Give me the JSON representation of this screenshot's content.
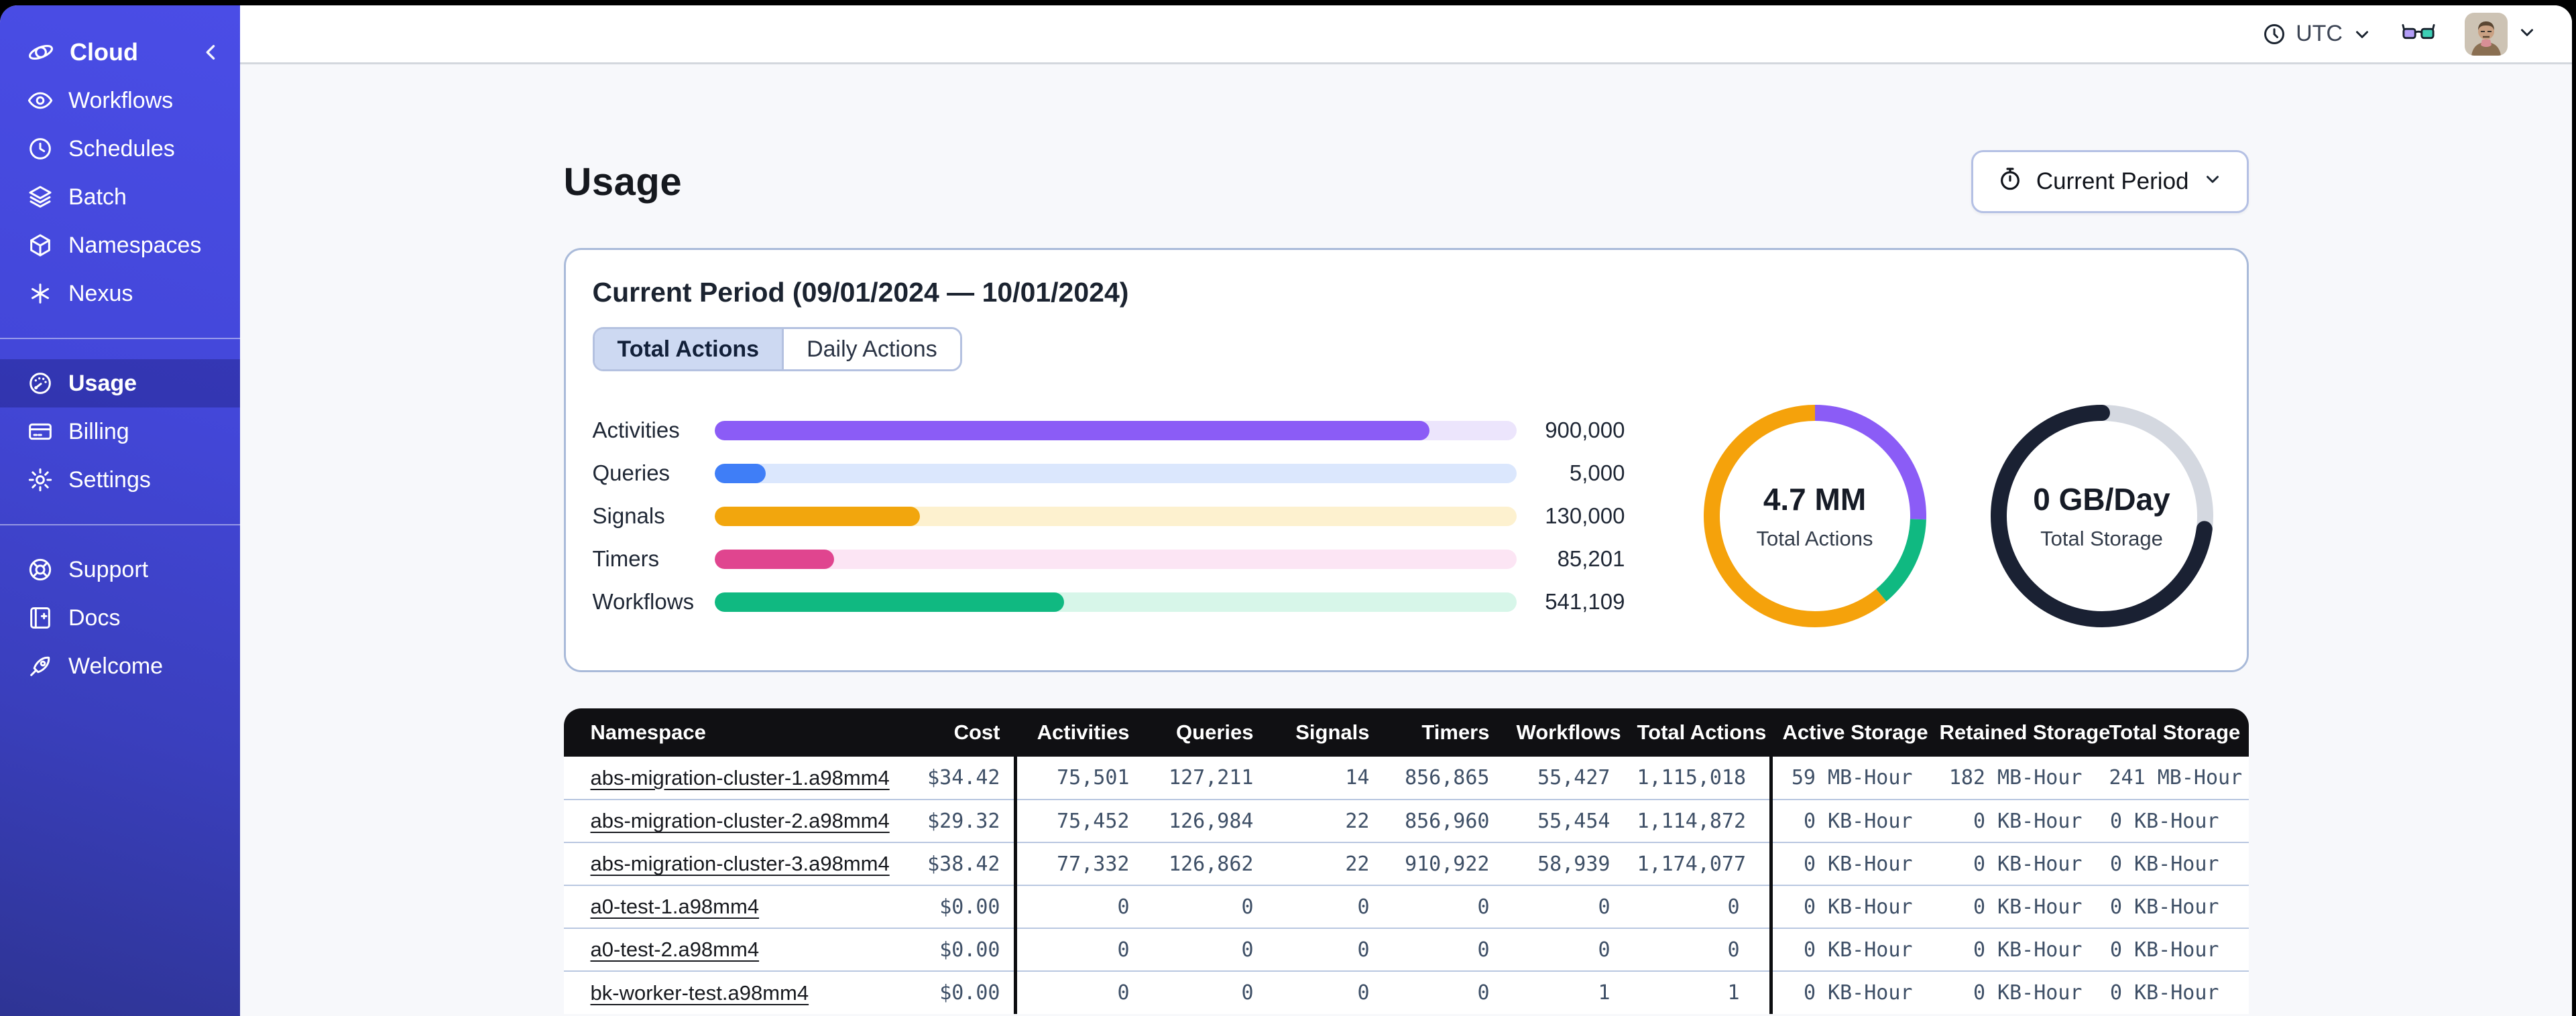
{
  "sidebar": {
    "brand": {
      "icon": "temporal-logo-icon",
      "label": "Cloud"
    },
    "groups": [
      [
        {
          "icon": "workflows-icon",
          "label": "Workflows"
        },
        {
          "icon": "schedules-icon",
          "label": "Schedules"
        },
        {
          "icon": "batch-icon",
          "label": "Batch"
        },
        {
          "icon": "namespaces-icon",
          "label": "Namespaces"
        },
        {
          "icon": "nexus-icon",
          "label": "Nexus"
        }
      ],
      [
        {
          "icon": "usage-icon",
          "label": "Usage",
          "active": true
        },
        {
          "icon": "billing-icon",
          "label": "Billing"
        },
        {
          "icon": "settings-icon",
          "label": "Settings"
        }
      ],
      [
        {
          "icon": "support-icon",
          "label": "Support"
        },
        {
          "icon": "docs-icon",
          "label": "Docs"
        },
        {
          "icon": "welcome-icon",
          "label": "Welcome"
        }
      ]
    ]
  },
  "topbar": {
    "timezone_label": "UTC",
    "icons": [
      "clock-icon",
      "chevron-down-icon",
      "glasses-icon",
      "user-avatar",
      "chevron-down-icon"
    ]
  },
  "page": {
    "title": "Usage",
    "period_button_label": "Current Period",
    "period_button_icon": "stopwatch-icon"
  },
  "card": {
    "title": "Current Period (09/01/2024 — 10/01/2024)",
    "tabs": [
      {
        "label": "Total Actions",
        "selected": true
      },
      {
        "label": "Daily Actions",
        "selected": false
      }
    ]
  },
  "chart_data": [
    {
      "type": "bar",
      "title": "Usage by action type (current period)",
      "orientation": "horizontal",
      "categories": [
        "Activities",
        "Queries",
        "Signals",
        "Timers",
        "Workflows"
      ],
      "values": [
        900000,
        5000,
        130000,
        85201,
        541109
      ],
      "value_labels": [
        "900,000",
        "5,000",
        "130,000",
        "85,201",
        "541,109"
      ],
      "fill_pct": [
        89.2,
        6.4,
        25.6,
        14.9,
        43.6
      ],
      "bar_colors": [
        "#8b5cf6",
        "#3f7ef7",
        "#f2a60d",
        "#e0458f",
        "#10b981"
      ],
      "track_colors": [
        "#ece5fc",
        "#dbe7fd",
        "#fdf1cf",
        "#fce5f4",
        "#d7f6e9"
      ]
    },
    {
      "type": "pie",
      "title": "Total Actions donut",
      "center_value": "4.7 MM",
      "center_label": "Total Actions",
      "rounded_caps": false,
      "segments": [
        {
          "name": "purple-segment",
          "color": "#8b5cf6",
          "pct": 25.5
        },
        {
          "name": "green-segment",
          "color": "#10b981",
          "pct": 13.4
        },
        {
          "name": "orange-segment",
          "color": "#f5a20b",
          "pct": 61.1
        }
      ]
    },
    {
      "type": "pie",
      "title": "Total Storage donut",
      "center_value": "0 GB/Day",
      "center_label": "Total Storage",
      "rounded_caps": true,
      "segments": [
        {
          "name": "gray-segment",
          "color": "#d4d8e0",
          "pct": 27.0,
          "round": false
        },
        {
          "name": "dark-segment",
          "color": "#1a2133",
          "pct": 73.0,
          "round": true
        }
      ]
    }
  ],
  "table": {
    "columns": [
      "Namespace",
      "Cost",
      "Activities",
      "Queries",
      "Signals",
      "Timers",
      "Workflows",
      "Total Actions",
      "Active Storage",
      "Retained Storage",
      "Total Storage"
    ],
    "rows": [
      [
        "abs-migration-cluster-1.a98mm4",
        "$34.42",
        "75,501",
        "127,211",
        "14",
        "856,865",
        "55,427",
        "1,115,018",
        "59 MB-Hour",
        "182 MB-Hour",
        "241 MB-Hour"
      ],
      [
        "abs-migration-cluster-2.a98mm4",
        "$29.32",
        "75,452",
        "126,984",
        "22",
        "856,960",
        "55,454",
        "1,114,872",
        "0 KB-Hour",
        "0 KB-Hour",
        "0 KB-Hour"
      ],
      [
        "abs-migration-cluster-3.a98mm4",
        "$38.42",
        "77,332",
        "126,862",
        "22",
        "910,922",
        "58,939",
        "1,174,077",
        "0 KB-Hour",
        "0 KB-Hour",
        "0 KB-Hour"
      ],
      [
        "a0-test-1.a98mm4",
        "$0.00",
        "0",
        "0",
        "0",
        "0",
        "0",
        "0",
        "0 KB-Hour",
        "0 KB-Hour",
        "0 KB-Hour"
      ],
      [
        "a0-test-2.a98mm4",
        "$0.00",
        "0",
        "0",
        "0",
        "0",
        "0",
        "0",
        "0 KB-Hour",
        "0 KB-Hour",
        "0 KB-Hour"
      ],
      [
        "bk-worker-test.a98mm4",
        "$0.00",
        "0",
        "0",
        "0",
        "0",
        "1",
        "1",
        "0 KB-Hour",
        "0 KB-Hour",
        "0 KB-Hour"
      ]
    ]
  }
}
